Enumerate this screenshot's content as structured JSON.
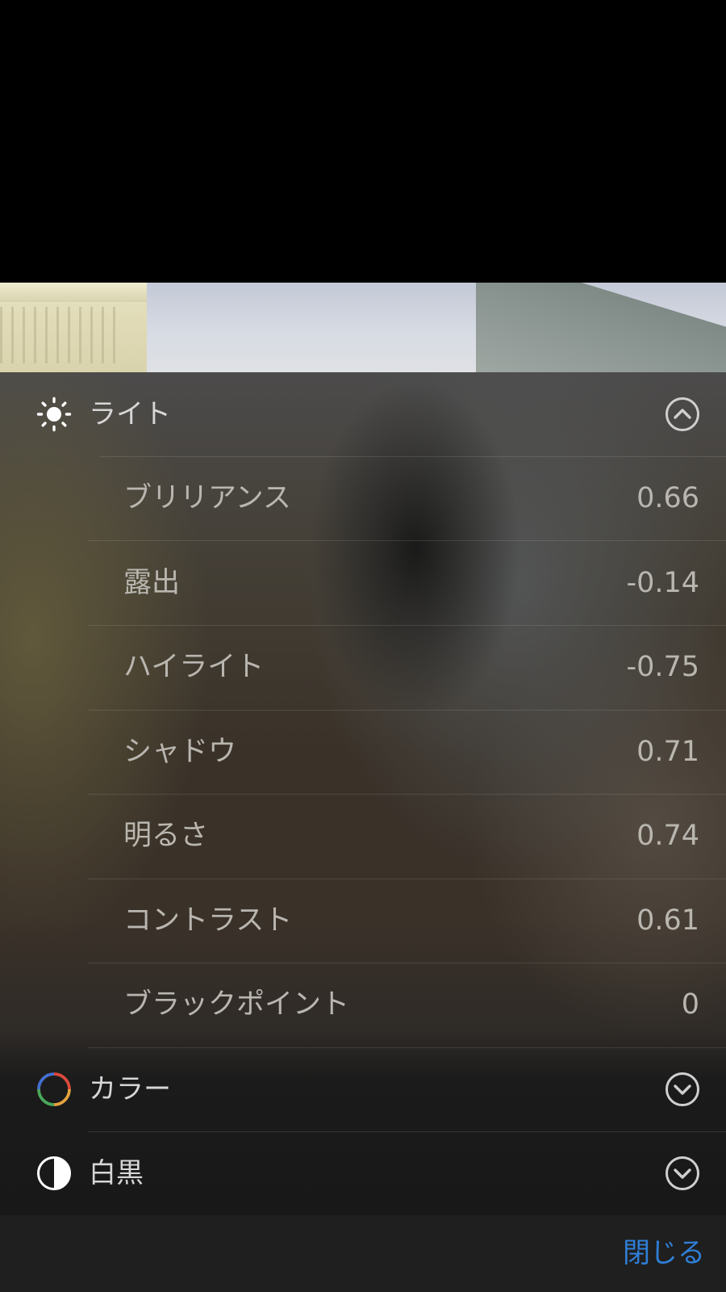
{
  "photo": {
    "description_icon": "photo-preview"
  },
  "adjustments": {
    "light": {
      "label": "ライト",
      "icon": "sun-icon",
      "expanded": true,
      "items": [
        {
          "label": "ブリリアンス",
          "value": "0.66"
        },
        {
          "label": "露出",
          "value": "-0.14"
        },
        {
          "label": "ハイライト",
          "value": "-0.75"
        },
        {
          "label": "シャドウ",
          "value": "0.71"
        },
        {
          "label": "明るさ",
          "value": "0.74"
        },
        {
          "label": "コントラスト",
          "value": "0.61"
        },
        {
          "label": "ブラックポイント",
          "value": "0"
        }
      ]
    },
    "color": {
      "label": "カラー",
      "icon": "color-wheel-icon",
      "expanded": false
    },
    "bw": {
      "label": "白黒",
      "icon": "half-circle-icon",
      "expanded": false
    }
  },
  "footer": {
    "close_label": "閉じる",
    "accent_color": "#2f7fd8"
  }
}
